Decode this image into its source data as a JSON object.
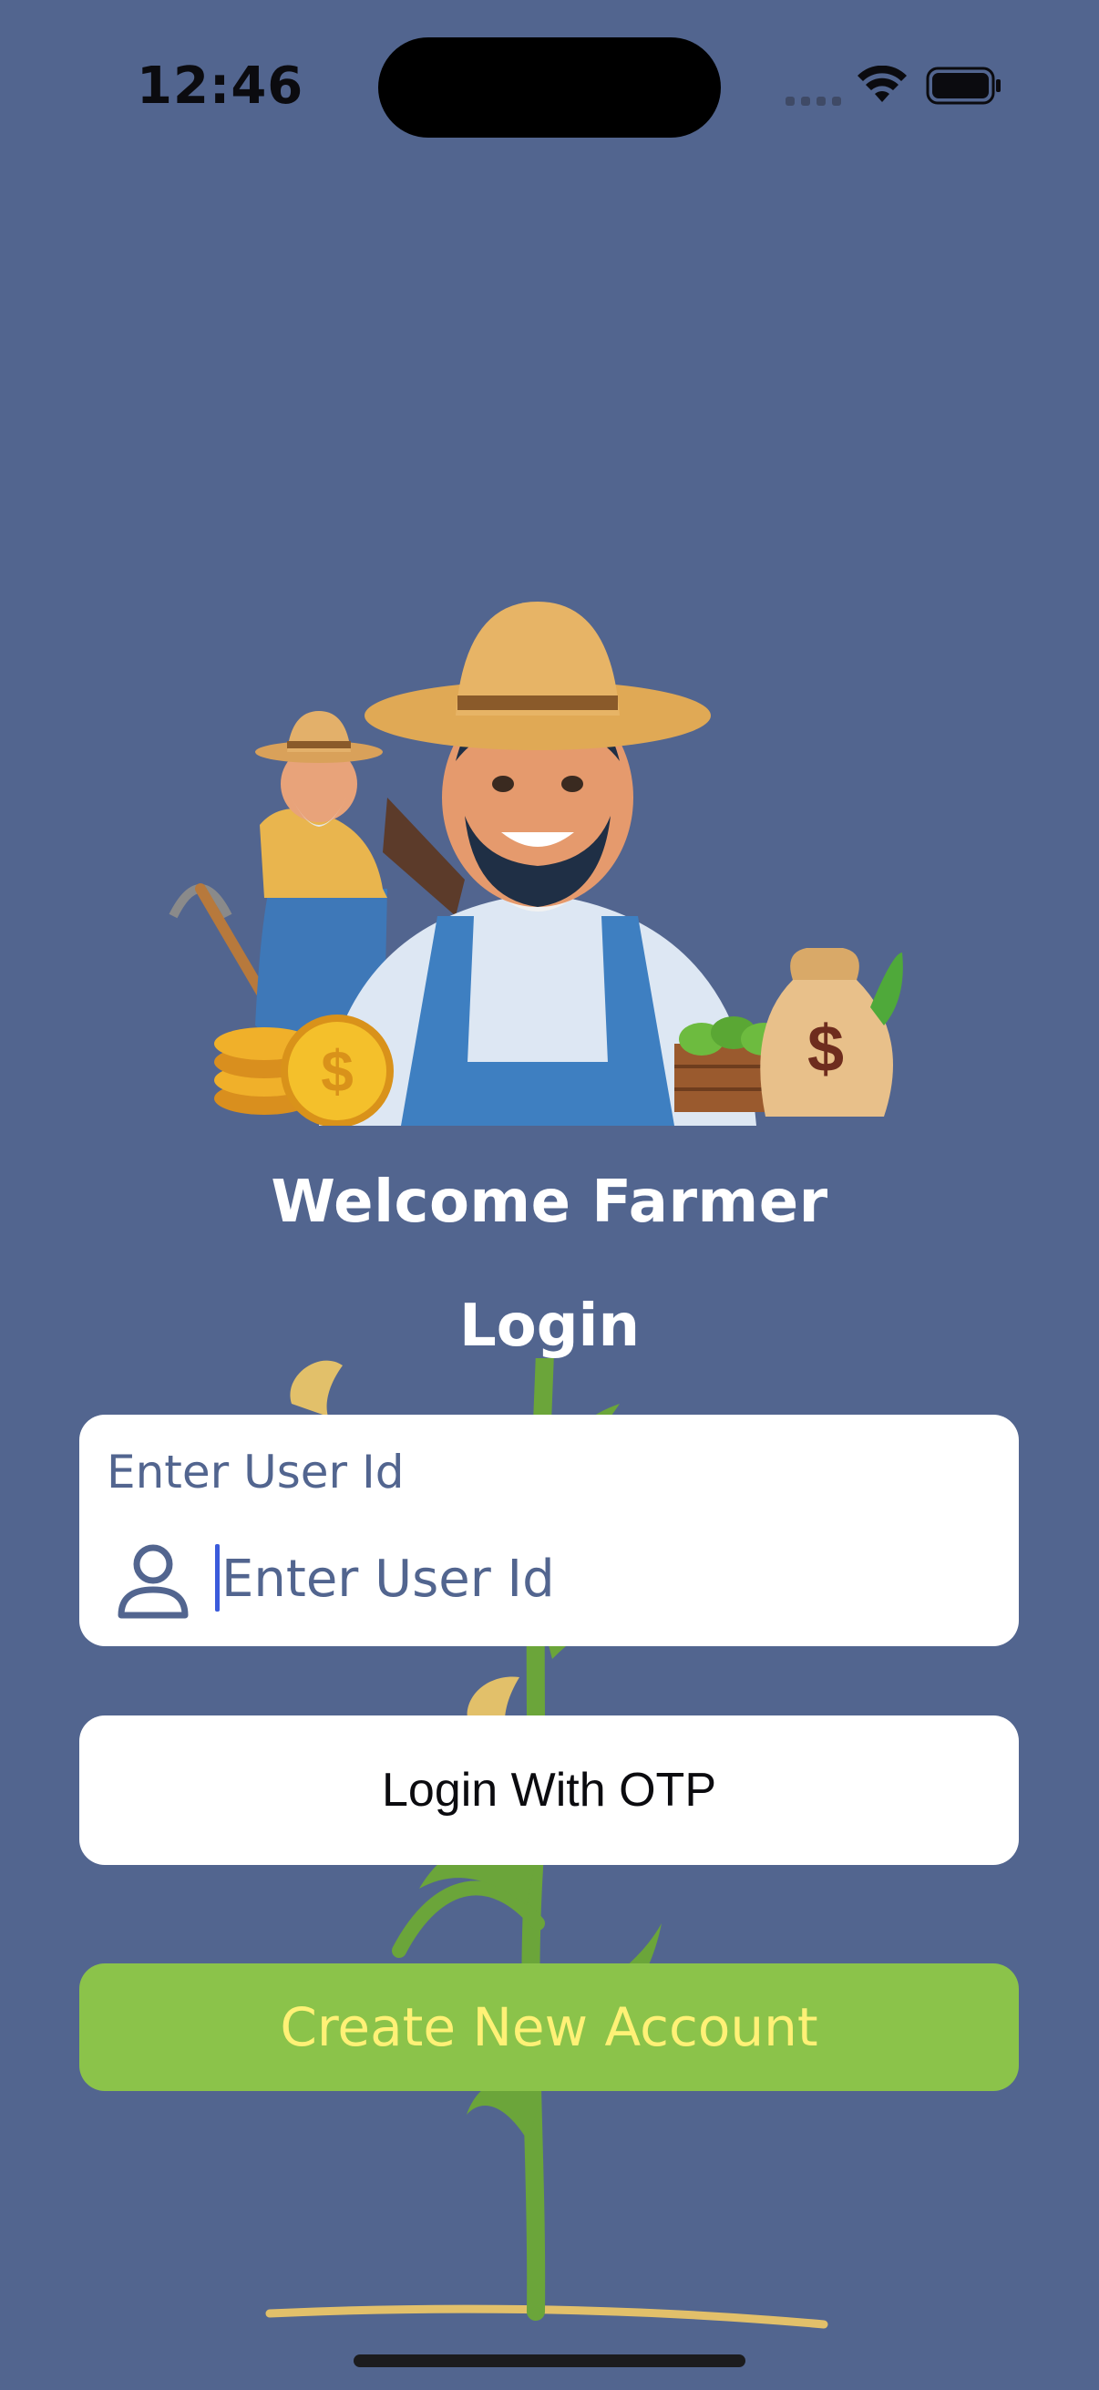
{
  "status_bar": {
    "time": "12:46"
  },
  "welcome": {
    "title": "Welcome Farmer",
    "subtitle": "Login"
  },
  "user_id_field": {
    "label": "Enter User Id",
    "placeholder": "Enter User Id",
    "value": ""
  },
  "buttons": {
    "otp_label": "Login With OTP",
    "create_label": "Create New Account"
  },
  "colors": {
    "background": "#52658F",
    "accent_green": "#8BC34A",
    "accent_yellow": "#FFF176",
    "card": "#FFFFFF"
  },
  "icons": {
    "user": "person-outline-icon",
    "wifi": "wifi-icon",
    "battery": "battery-icon",
    "signal": "cellular-signal-icon"
  }
}
